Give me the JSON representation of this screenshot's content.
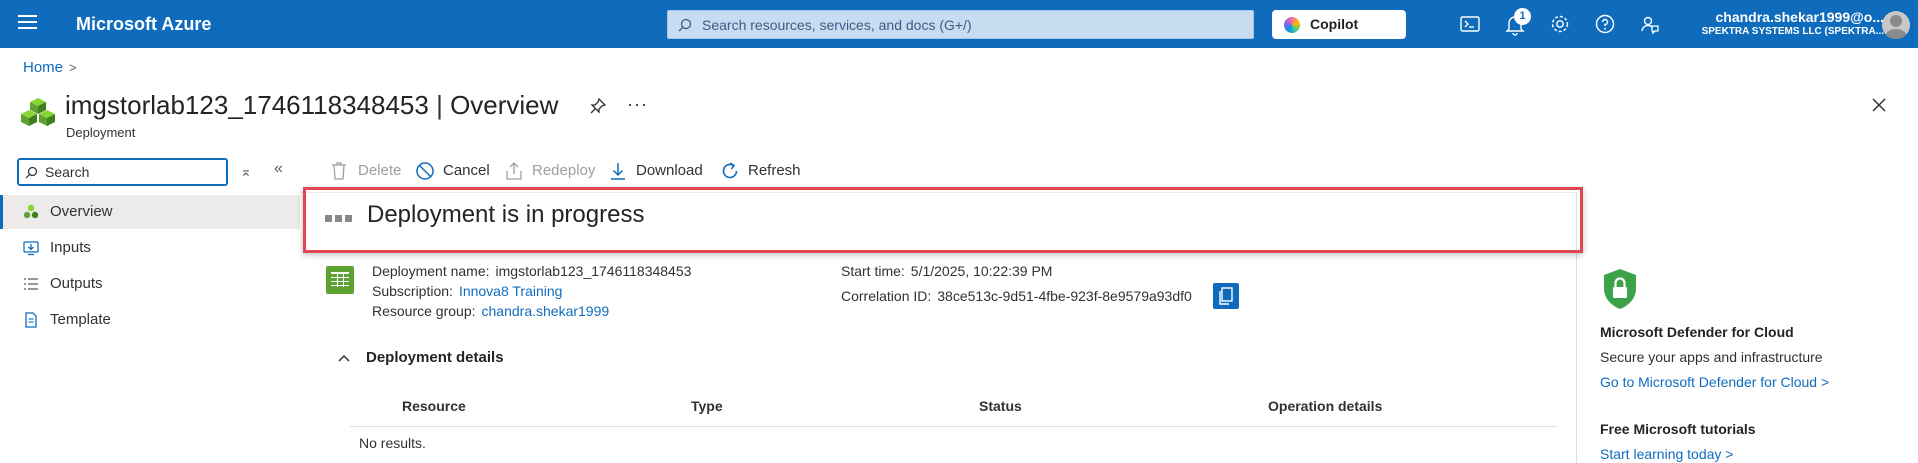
{
  "topbar": {
    "brand": "Microsoft Azure",
    "search_placeholder": "Search resources, services, and docs (G+/)",
    "copilot_label": "Copilot",
    "notification_count": "1",
    "account_email": "chandra.shekar1999@o...",
    "account_org": "SPEKTRA SYSTEMS LLC (SPEKTRA...",
    "icons": [
      "menu-icon",
      "search-icon",
      "cloud-shell-icon",
      "notifications-icon",
      "settings-icon",
      "help-icon",
      "feedback-icon",
      "avatar"
    ],
    "color": "#0f6cbd"
  },
  "breadcrumb": {
    "home": "Home"
  },
  "header": {
    "name": "imgstorlab123_1746118348453",
    "separator": "|",
    "section": "Overview",
    "subtitle": "Deployment"
  },
  "nav": {
    "search_placeholder": "Search",
    "items": [
      {
        "label": "Overview",
        "icon": "overview-icon",
        "active": true
      },
      {
        "label": "Inputs",
        "icon": "inputs-icon"
      },
      {
        "label": "Outputs",
        "icon": "outputs-icon"
      },
      {
        "label": "Template",
        "icon": "template-icon"
      }
    ]
  },
  "toolbar": {
    "delete": "Delete",
    "cancel": "Cancel",
    "redeploy": "Redeploy",
    "download": "Download",
    "refresh": "Refresh"
  },
  "status": {
    "text": "Deployment is in progress",
    "highlight_color": "#e0484f"
  },
  "essentials": {
    "deployment_name_label": "Deployment name:",
    "deployment_name": "imgstorlab123_1746118348453",
    "subscription_label": "Subscription:",
    "subscription": "Innova8 Training",
    "resource_group_label": "Resource group:",
    "resource_group": "chandra.shekar1999",
    "start_time_label": "Start time:",
    "start_time": "5/1/2025, 10:22:39 PM",
    "correlation_label": "Correlation ID:",
    "correlation_id": "38ce513c-9d51-4fbe-923f-8e9579a93df0"
  },
  "details": {
    "title": "Deployment details",
    "columns": [
      "Resource",
      "Type",
      "Status",
      "Operation details"
    ],
    "empty": "No results."
  },
  "side_panel": {
    "defender_title": "Microsoft Defender for Cloud",
    "defender_text": "Secure your apps and infrastructure",
    "defender_link": "Go to Microsoft Defender for Cloud >",
    "tutorials_title": "Free Microsoft tutorials",
    "tutorials_link": "Start learning today >"
  }
}
